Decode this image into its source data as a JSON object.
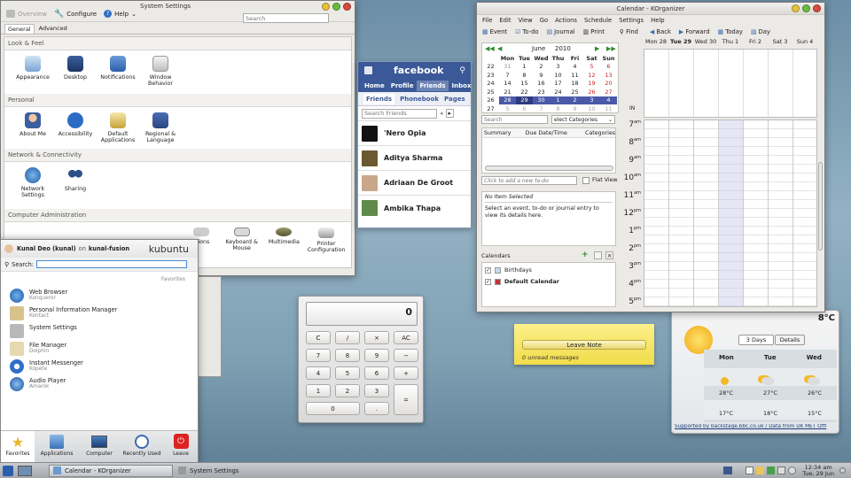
{
  "system_settings": {
    "title": "System Settings",
    "toolbar": {
      "overview": "Overview",
      "configure": "Configure",
      "help": "Help"
    },
    "search_placeholder": "Search",
    "tabs": [
      "General",
      "Advanced"
    ],
    "sections": [
      {
        "title": "Look & Feel",
        "items": [
          "Appearance",
          "Desktop",
          "Notifications",
          "Window Behavior"
        ]
      },
      {
        "title": "Personal",
        "items": [
          "About Me",
          "Accessibility",
          "Default Applications",
          "Regional & Language"
        ]
      },
      {
        "title": "Network & Connectivity",
        "items": [
          "Network Settings",
          "Sharing"
        ]
      },
      {
        "title": "Computer Administration",
        "items": [
          "Keyboard & Mouse",
          "Multimedia",
          "Printer Configuration"
        ]
      }
    ],
    "partial_item": "ctions"
  },
  "facebook": {
    "logo": "facebook",
    "nav": [
      "Home",
      "Profile",
      "Friends",
      "Inbox"
    ],
    "subnav": [
      "Friends",
      "Phonebook",
      "Pages"
    ],
    "search_placeholder": "Search Friends",
    "friends": [
      "'Nero Opia",
      "Aditya Sharma",
      "Adriaan De Groot",
      "Ambika Thapa"
    ]
  },
  "kickoff": {
    "user": "Kunal Deo (kunal)",
    "on": "on",
    "host": "kunal-fusion",
    "brand": "kubuntu",
    "search_label": "Search:",
    "favorites_label": "Favorites",
    "items": [
      {
        "name": "Web Browser",
        "sub": "Konqueror"
      },
      {
        "name": "Personal Information Manager",
        "sub": "Kontact"
      },
      {
        "name": "System Settings",
        "sub": ""
      },
      {
        "name": "File Manager",
        "sub": "Dolphin"
      },
      {
        "name": "Instant Messenger",
        "sub": "Kopete"
      },
      {
        "name": "Audio Player",
        "sub": "Amarok"
      }
    ],
    "tabs": [
      "Favorites",
      "Applications",
      "Computer",
      "Recently Used",
      "Leave"
    ]
  },
  "calculator": {
    "display": "0",
    "buttons": [
      [
        "C",
        "/",
        "×",
        "AC"
      ],
      [
        "7",
        "8",
        "9",
        "−"
      ],
      [
        "4",
        "5",
        "6",
        "+"
      ],
      [
        "1",
        "2",
        "3",
        "="
      ],
      [
        "0",
        "."
      ]
    ]
  },
  "korganizer": {
    "title": "Calendar - KOrganizer",
    "menu": [
      "File",
      "Edit",
      "View",
      "Go",
      "Actions",
      "Schedule",
      "Settings",
      "Help"
    ],
    "toolbar": [
      "Event",
      "To-do",
      "Journal",
      "Print",
      "Find",
      "Back",
      "Forward",
      "Today",
      "Day"
    ],
    "month": "June",
    "year": "2010",
    "weekdays": [
      "Mon",
      "Tue",
      "Wed",
      "Thu",
      "Fri",
      "Sat",
      "Sun"
    ],
    "weeks": [
      {
        "wk": "22",
        "days": [
          "31",
          "1",
          "2",
          "3",
          "4",
          "5",
          "6"
        ]
      },
      {
        "wk": "23",
        "days": [
          "7",
          "8",
          "9",
          "10",
          "11",
          "12",
          "13"
        ]
      },
      {
        "wk": "24",
        "days": [
          "14",
          "15",
          "16",
          "17",
          "18",
          "19",
          "20"
        ]
      },
      {
        "wk": "25",
        "days": [
          "21",
          "22",
          "23",
          "24",
          "25",
          "26",
          "27"
        ]
      },
      {
        "wk": "26",
        "days": [
          "28",
          "29",
          "30",
          "1",
          "2",
          "3",
          "4"
        ]
      },
      {
        "wk": "27",
        "days": [
          "5",
          "6",
          "7",
          "8",
          "9",
          "10",
          "11"
        ]
      }
    ],
    "search_placeholder": "Search",
    "category_select": "elect Categories",
    "todo_headers": [
      "Summary",
      "Due Date/Time",
      "Categories"
    ],
    "todo_placeholder": "Click to add a new to-do",
    "flat_view": "Flat View",
    "no_item": "No Item Selected",
    "hint": "Select an event, to-do or journal entry to view its details here.",
    "calendars_label": "Calendars",
    "calendars": [
      "Birthdays",
      "Default Calendar"
    ],
    "day_headers": [
      "Mon 28",
      "Tue 29",
      "Wed 30",
      "Thu 1",
      "Fri 2",
      "Sat 3",
      "Sun 4"
    ],
    "in_label": "IN",
    "hours": [
      "7",
      "8",
      "9",
      "10",
      "11",
      "12",
      "1",
      "2",
      "3",
      "4",
      "5"
    ],
    "hour_suffix": [
      "am",
      "am",
      "am",
      "am",
      "am",
      "pm",
      "pm",
      "pm",
      "pm",
      "pm",
      "pm"
    ],
    "accent": "#4a5aa8"
  },
  "notes": {
    "leave_note": "Leave Note",
    "unread": "0 unread messages"
  },
  "weather": {
    "temp_partial": "8°C",
    "tabs": [
      "3 Days",
      "Details"
    ],
    "days": [
      "Mon",
      "Tue",
      "Wed"
    ],
    "highs": [
      "28°C",
      "27°C",
      "26°C"
    ],
    "lows": [
      "17°C",
      "18°C",
      "15°C"
    ],
    "credit": "Supported by backstage.bbc.co.uk / Data from UK MET Offi"
  },
  "taskbar": {
    "tasks": [
      "Calendar - KOrganizer",
      "System Settings"
    ],
    "time": "12:34 am",
    "date": "Tue, 29 Jun"
  }
}
